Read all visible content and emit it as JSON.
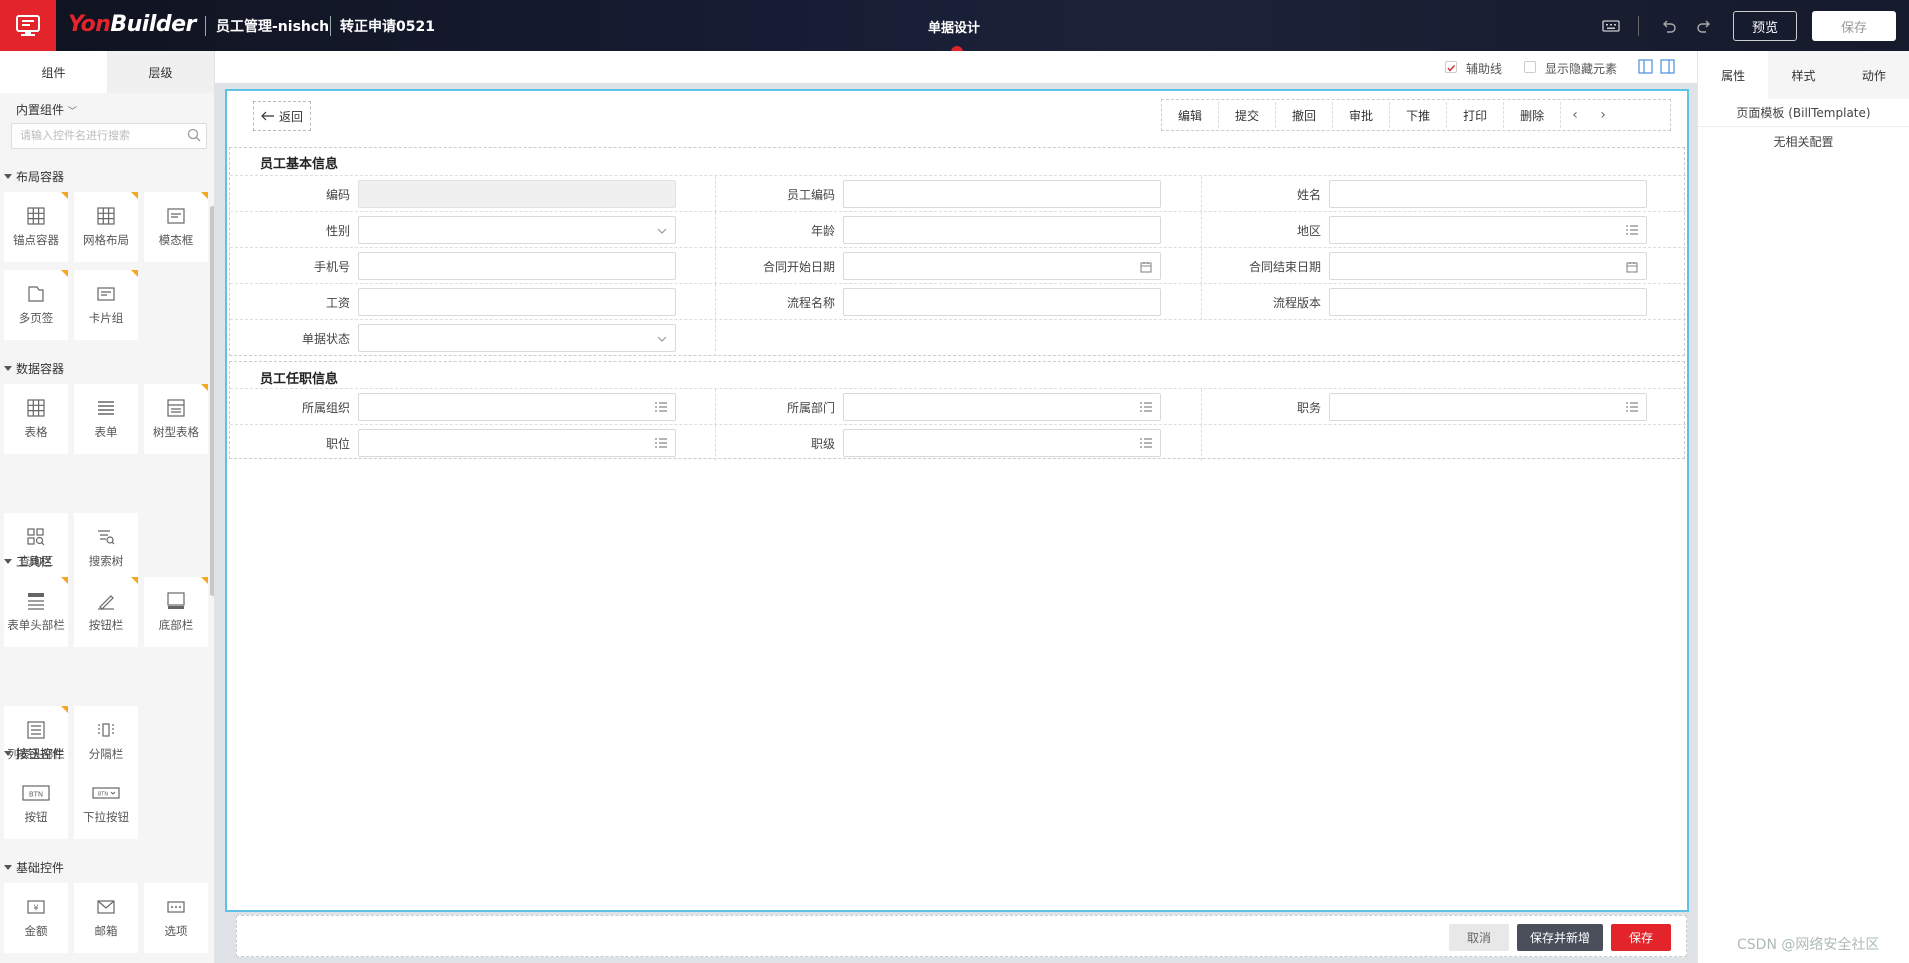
{
  "topbar": {
    "brand_a": "Yon",
    "brand_b": "Builder",
    "app_name": "员工管理-nishch",
    "doc_name": "转正申请0521",
    "page_title": "单据设计",
    "preview_label": "预览",
    "save_label": "保存",
    "accent": "#e3242b"
  },
  "left": {
    "tabs": [
      "组件",
      "层级"
    ],
    "builtin_label": "内置组件",
    "search_placeholder": "请输入控件名进行搜索",
    "groups": {
      "layout": {
        "title": "布局容器",
        "items": [
          "锚点容器",
          "网格布局",
          "模态框",
          "多页签",
          "卡片组"
        ]
      },
      "data": {
        "title": "数据容器",
        "items": [
          "表格",
          "表单",
          "树型表格",
          "查询区",
          "搜索树"
        ]
      },
      "toolbar": {
        "title": "工具栏",
        "items": [
          "表单头部栏",
          "按钮栏",
          "底部栏",
          "列表头部栏",
          "分隔栏"
        ]
      },
      "button": {
        "title": "按钮控件",
        "items": [
          "按钮",
          "下拉按钮"
        ]
      },
      "basic": {
        "title": "基础控件",
        "items": [
          "金额",
          "邮箱",
          "选项"
        ]
      }
    }
  },
  "canvas": {
    "show_guides_label": "辅助线",
    "show_hidden_label": "显示隐藏元素",
    "back_label": "返回",
    "actions": [
      "编辑",
      "提交",
      "撤回",
      "审批",
      "下推",
      "打印",
      "删除"
    ],
    "sections": [
      {
        "title": "员工基本信息",
        "rows": [
          [
            {
              "label": "编码",
              "icon": "",
              "disabled": true
            },
            {
              "label": "员工编码",
              "icon": ""
            },
            {
              "label": "姓名",
              "icon": ""
            }
          ],
          [
            {
              "label": "性别",
              "icon": "chevron-down-icon"
            },
            {
              "label": "年龄",
              "icon": ""
            },
            {
              "label": "地区",
              "icon": "list-icon"
            }
          ],
          [
            {
              "label": "手机号",
              "icon": ""
            },
            {
              "label": "合同开始日期",
              "icon": "calendar-icon"
            },
            {
              "label": "合同结束日期",
              "icon": "calendar-icon"
            }
          ],
          [
            {
              "label": "工资",
              "icon": ""
            },
            {
              "label": "流程名称",
              "icon": ""
            },
            {
              "label": "流程版本",
              "icon": ""
            }
          ],
          [
            {
              "label": "单据状态",
              "icon": "chevron-down-icon"
            }
          ]
        ]
      },
      {
        "title": "员工任职信息",
        "rows": [
          [
            {
              "label": "所属组织",
              "icon": "list-icon"
            },
            {
              "label": "所属部门",
              "icon": "list-icon"
            },
            {
              "label": "职务",
              "icon": "list-icon"
            }
          ],
          [
            {
              "label": "职位",
              "icon": "list-icon"
            },
            {
              "label": "职级",
              "icon": "list-icon"
            }
          ]
        ]
      }
    ]
  },
  "footer": {
    "cancel_label": "取消",
    "save_new_label": "保存并新增",
    "save_label": "保存"
  },
  "right": {
    "tabs": [
      "属性",
      "样式",
      "动作"
    ],
    "template_label": "页面模板 (BillTemplate)",
    "no_config_label": "无相关配置"
  },
  "watermark": "CSDN @网络安全社区"
}
